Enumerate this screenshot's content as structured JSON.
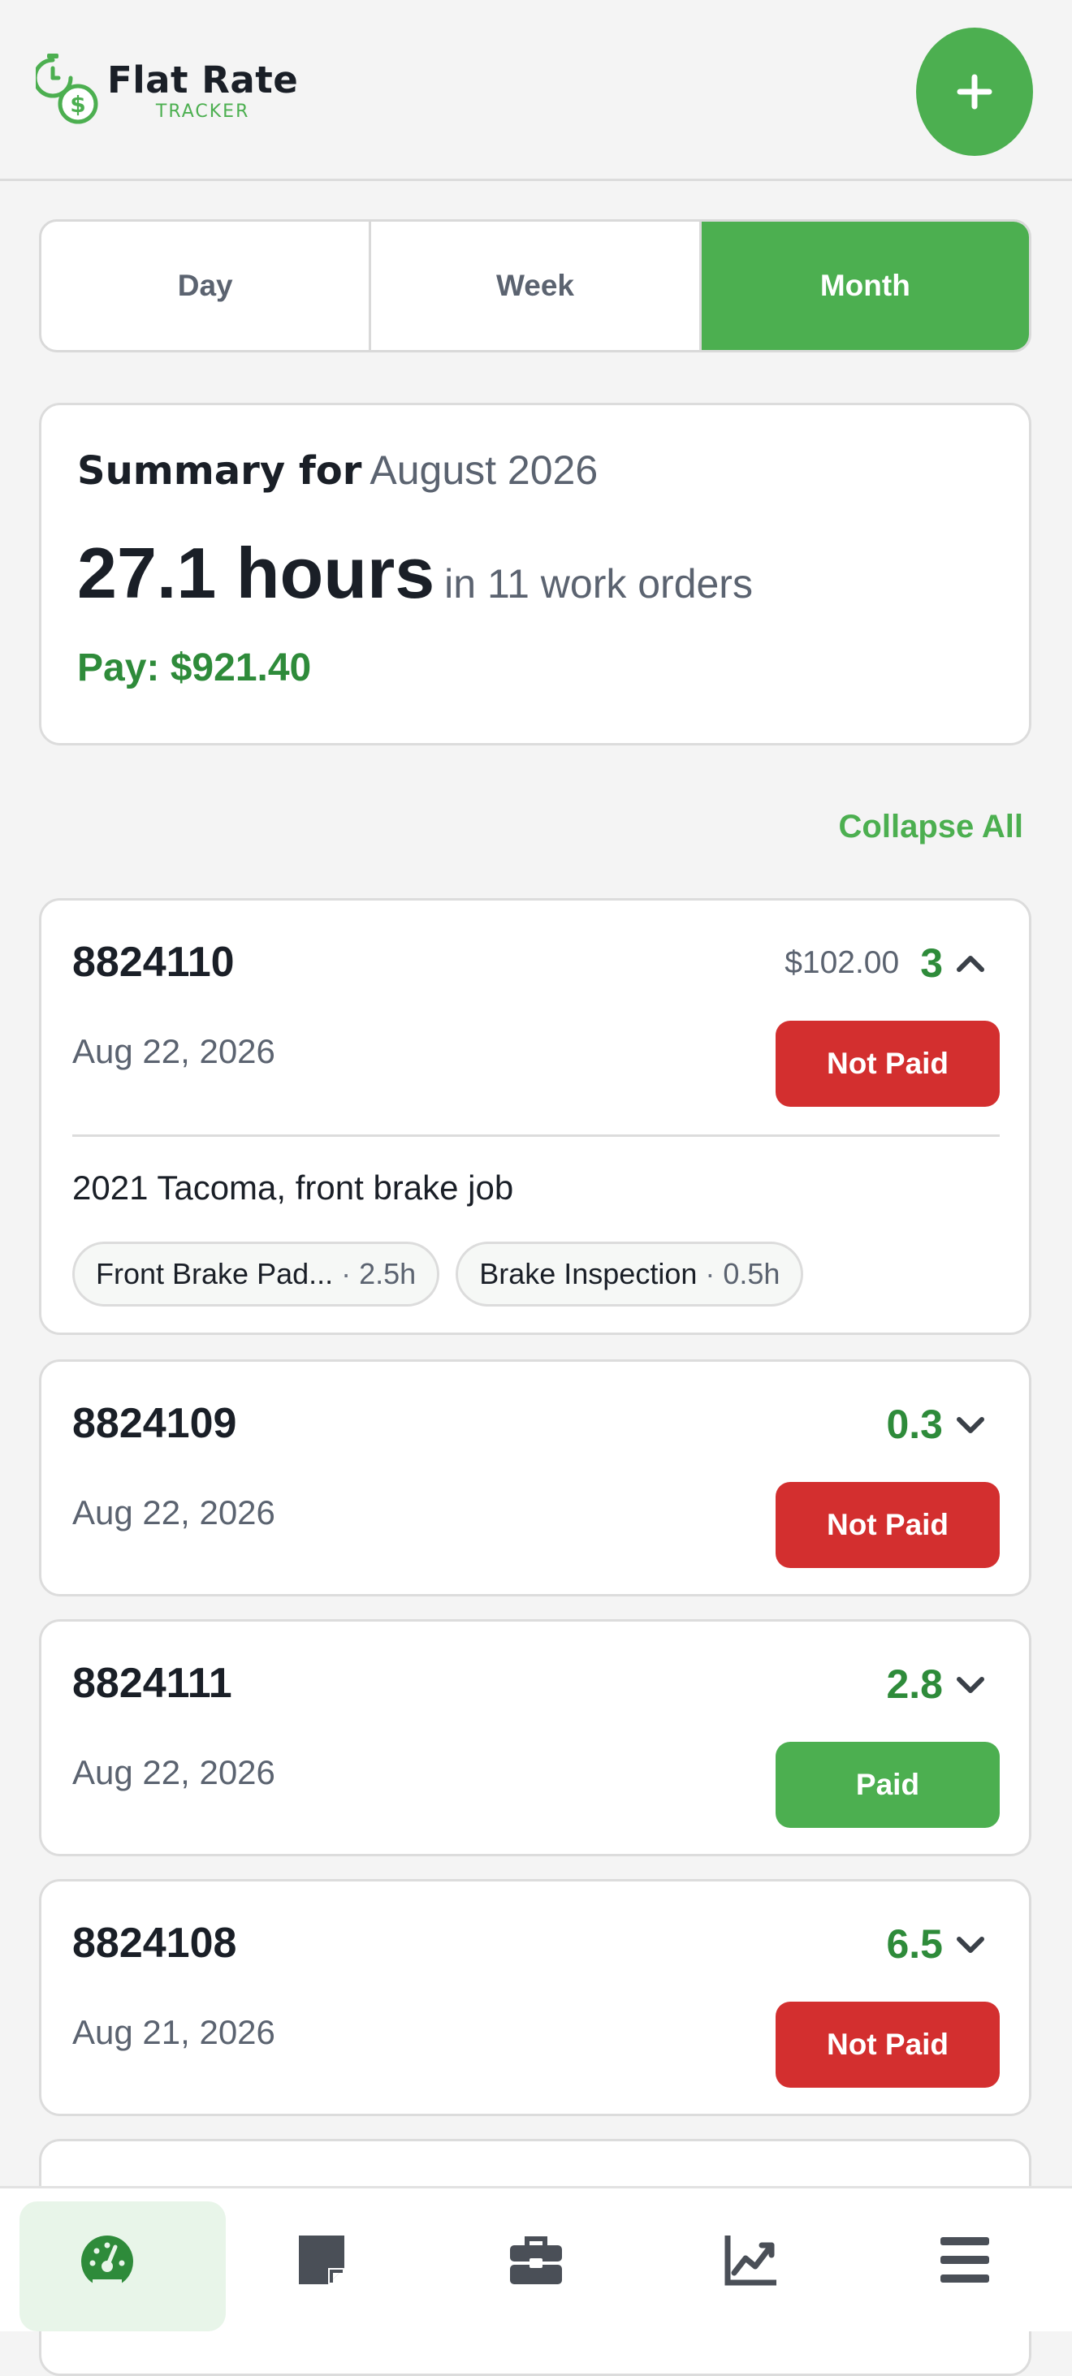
{
  "app": {
    "name": "Flat Rate",
    "subtitle": "TRACKER",
    "brand_color": "#4caf50",
    "fab_icon": "plus-icon"
  },
  "period_tabs": [
    {
      "label": "Day",
      "active": false
    },
    {
      "label": "Week",
      "active": false
    },
    {
      "label": "Month",
      "active": true
    }
  ],
  "summary": {
    "label": "Summary for",
    "period": "August 2026",
    "hours": "27.1 hours",
    "orders": "in 11 work orders",
    "pay": "Pay: $921.40"
  },
  "collapse_label": "Collapse All",
  "work_orders": [
    {
      "number": "8824110",
      "pay": "$102.00",
      "hours": "3",
      "date": "Aug 22, 2026",
      "status": "Not Paid",
      "expanded": true,
      "description": "2021 Tacoma, front brake job",
      "tasks": [
        {
          "name": "Front Brake Pad...",
          "hours": "2.5h"
        },
        {
          "name": "Brake Inspection",
          "hours": "0.5h"
        }
      ]
    },
    {
      "number": "8824109",
      "hours": "0.3",
      "date": "Aug 22, 2026",
      "status": "Not Paid",
      "expanded": false
    },
    {
      "number": "8824111",
      "hours": "2.8",
      "date": "Aug 22, 2026",
      "status": "Paid",
      "expanded": false
    },
    {
      "number": "8824108",
      "hours": "6.5",
      "date": "Aug 21, 2026",
      "status": "Not Paid",
      "expanded": false
    }
  ],
  "bottom_nav": [
    {
      "icon": "dashboard-gauge-icon",
      "active": true
    },
    {
      "icon": "note-icon",
      "active": false
    },
    {
      "icon": "toolbox-icon",
      "active": false
    },
    {
      "icon": "chart-line-icon",
      "active": false
    },
    {
      "icon": "menu-icon",
      "active": false
    }
  ],
  "colors": {
    "accent": "#4caf50",
    "hours_green": "#2e8b3a",
    "not_paid": "#d32f2f",
    "paid": "#4caf50"
  }
}
